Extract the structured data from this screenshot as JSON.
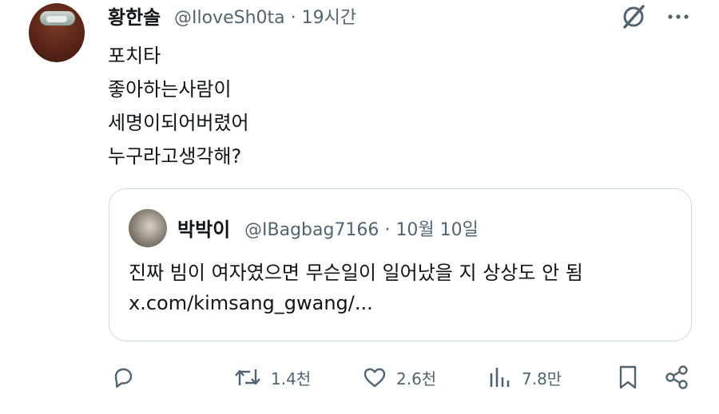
{
  "tweet": {
    "display_name": "황한솔",
    "handle": "@IloveSh0ta",
    "separator": "·",
    "time": "19시간",
    "lines": [
      "포치타",
      "좋아하는사람이",
      "세명이되어버렸어",
      "누구라고생각해?"
    ]
  },
  "quoted": {
    "display_name": "박박이",
    "handle": "@IBagbag7166",
    "separator": "·",
    "date": "10월 10일",
    "text": "진짜 빔이 여자였으면 무슨일이 일어났을 지 상상도 안 됨",
    "link": "x.com/kimsang_gwang/..."
  },
  "actions": {
    "reply_icon": "reply-icon",
    "retweet_count": "1.4천",
    "like_count": "2.6천",
    "views_count": "7.8만",
    "bookmark_icon": "bookmark-icon",
    "share_icon": "share-icon"
  },
  "colors": {
    "text": "#0f1419",
    "secondary": "#536471",
    "border": "#cfd9de"
  }
}
